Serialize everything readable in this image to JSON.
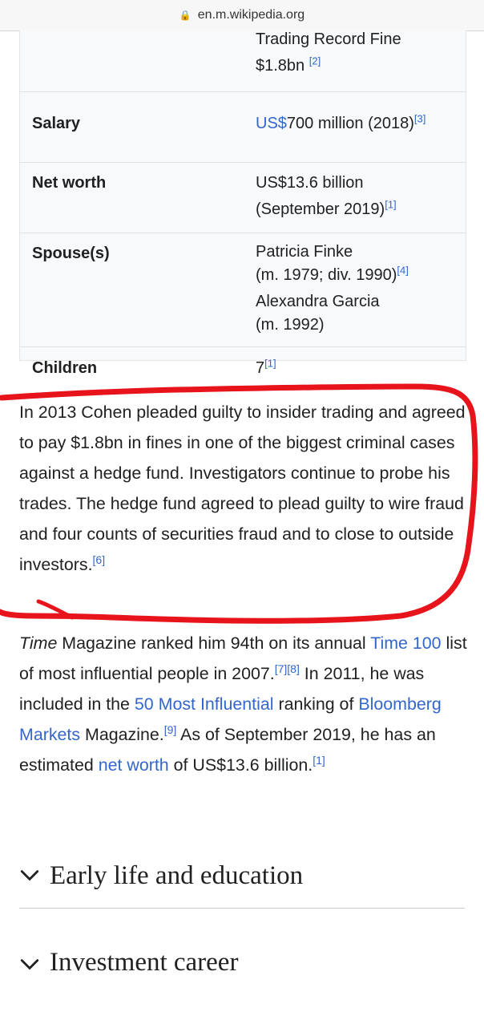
{
  "browser": {
    "url": "en.m.wikipedia.org"
  },
  "infobox": {
    "trading_line1": "Trading Record Fine",
    "trading_line2": "$1.8bn",
    "trading_ref": "[2]",
    "salary_label": "Salary",
    "salary_link": "US$",
    "salary_value": "700 million (2018)",
    "salary_ref": "[3]",
    "networth_label": "Net worth",
    "networth_line1": "US$13.6 billion",
    "networth_line2": "(September 2019)",
    "networth_ref": "[1]",
    "spouse_label": "Spouse(s)",
    "spouse1_name": "Patricia Finke",
    "spouse1_dates": "(m. 1979; div. 1990)",
    "spouse1_ref": "[4]",
    "spouse2_name": "Alexandra Garcia",
    "spouse2_dates": "(m. 1992)",
    "children_label": "Children",
    "children_value": "7",
    "children_ref": "[1]"
  },
  "para1": {
    "text": "In 2013 Cohen pleaded guilty to insider trading and agreed to pay $1.8bn in fines in one of the biggest criminal cases against a hedge fund. Investigators continue to probe his trades. The hedge fund agreed to plead guilty to wire fraud and four counts of securities fraud and to close to outside investors.",
    "ref": "[6]"
  },
  "para2": {
    "time_italic": "Time",
    "t1": " Magazine ranked him 94th on its annual ",
    "link_time100": "Time 100",
    "t2": " list of most influential people in 2007.",
    "ref7": "[7]",
    "ref8": "[8]",
    "t3": " In 2011, he was included in the ",
    "link_50": "50 Most Influential",
    "t4": " ranking of ",
    "link_bloomberg": "Bloomberg Markets",
    "t5": " Magazine.",
    "ref9": "[9]",
    "t6": " As of September 2019, he has an estimated ",
    "link_networth": "net worth",
    "t7": " of US$13.6 billion.",
    "ref1": "[1]"
  },
  "sections": {
    "early_life": "Early life and education",
    "investment": "Investment career"
  },
  "colors": {
    "link": "#3366cc",
    "annotation": "#e8141b",
    "text": "#202122"
  }
}
